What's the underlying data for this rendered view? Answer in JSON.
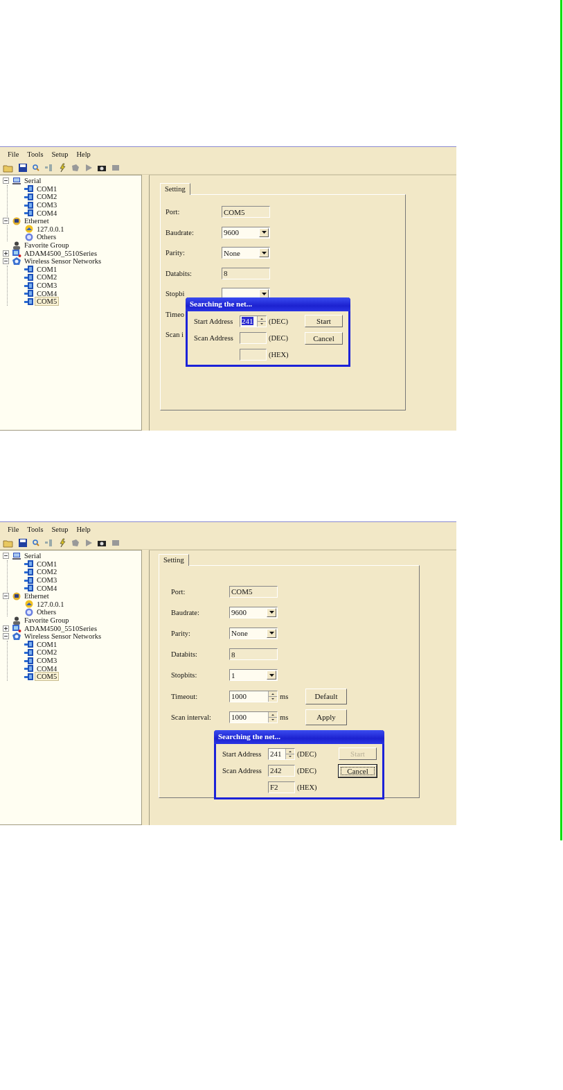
{
  "screenshots": [
    {
      "menu": [
        "File",
        "Tools",
        "Setup",
        "Help"
      ],
      "tree": [
        {
          "label": "Serial",
          "kind": "serial",
          "expanded": true,
          "selected": false,
          "children": [
            {
              "label": "COM1",
              "kind": "port",
              "selected": false
            },
            {
              "label": "COM2",
              "kind": "port",
              "selected": false
            },
            {
              "label": "COM3",
              "kind": "port",
              "selected": false
            },
            {
              "label": "COM4",
              "kind": "port",
              "selected": false
            }
          ]
        },
        {
          "label": "Ethernet",
          "kind": "ethernet",
          "expanded": true,
          "selected": false,
          "children": [
            {
              "label": "127.0.0.1",
              "kind": "host",
              "selected": false
            },
            {
              "label": "Others",
              "kind": "others",
              "selected": false
            }
          ]
        },
        {
          "label": "Favorite Group",
          "kind": "group",
          "selected": false
        },
        {
          "label": "ADAM4500_5510Series",
          "kind": "device",
          "expanded": false,
          "selected": false
        },
        {
          "label": "Wireless Sensor Networks",
          "kind": "wireless",
          "expanded": true,
          "selected": false,
          "children": [
            {
              "label": "COM1",
              "kind": "port",
              "selected": false
            },
            {
              "label": "COM2",
              "kind": "port",
              "selected": false
            },
            {
              "label": "COM3",
              "kind": "port",
              "selected": false
            },
            {
              "label": "COM4",
              "kind": "port",
              "selected": false
            },
            {
              "label": "COM5",
              "kind": "port",
              "selected": true
            }
          ]
        }
      ],
      "tabs": [
        {
          "label": "Setting",
          "selected": true
        }
      ],
      "form": [
        {
          "label": "Port:",
          "kind": "text",
          "value": "COM5"
        },
        {
          "label": "Baudrate:",
          "kind": "dropdown",
          "value": "9600"
        },
        {
          "label": "Parity:",
          "kind": "dropdown",
          "value": "None"
        },
        {
          "label": "Databits:",
          "kind": "text",
          "value": "8"
        },
        {
          "label": "Stopbi",
          "kind": "dropdown"
        },
        {
          "label": "Timeo",
          "kind": "none"
        },
        {
          "label": "Scan i",
          "kind": "none"
        }
      ],
      "dialog": {
        "title": "Searching the net...",
        "rows": [
          {
            "label": "Start Address",
            "kind": "spin",
            "value": "241",
            "value_selected": true,
            "unit": "(DEC)"
          },
          {
            "label": "Scan Address",
            "kind": "text",
            "unit": "(DEC)"
          },
          {
            "kind": "text",
            "unit": "(HEX)"
          }
        ],
        "buttons": [
          {
            "label": "Start",
            "disabled": false,
            "focused": false
          },
          {
            "label": "Cancel",
            "disabled": false,
            "focused": false
          }
        ]
      }
    },
    {
      "menu": [
        "File",
        "Tools",
        "Setup",
        "Help"
      ],
      "tree": [
        {
          "label": "Serial",
          "kind": "serial",
          "expanded": true,
          "selected": false,
          "children": [
            {
              "label": "COM1",
              "kind": "port",
              "selected": false
            },
            {
              "label": "COM2",
              "kind": "port",
              "selected": false
            },
            {
              "label": "COM3",
              "kind": "port",
              "selected": false
            },
            {
              "label": "COM4",
              "kind": "port",
              "selected": false
            }
          ]
        },
        {
          "label": "Ethernet",
          "kind": "ethernet",
          "expanded": true,
          "selected": false,
          "children": [
            {
              "label": "127.0.0.1",
              "kind": "host",
              "selected": false
            },
            {
              "label": "Others",
              "kind": "others",
              "selected": false
            }
          ]
        },
        {
          "label": "Favorite Group",
          "kind": "group",
          "selected": false
        },
        {
          "label": "ADAM4500_5510Series",
          "kind": "device",
          "expanded": false,
          "selected": false
        },
        {
          "label": "Wireless Sensor Networks",
          "kind": "wireless",
          "expanded": true,
          "selected": false,
          "children": [
            {
              "label": "COM1",
              "kind": "port",
              "selected": false
            },
            {
              "label": "COM2",
              "kind": "port",
              "selected": false
            },
            {
              "label": "COM3",
              "kind": "port",
              "selected": false
            },
            {
              "label": "COM4",
              "kind": "port",
              "selected": false
            },
            {
              "label": "COM5",
              "kind": "port",
              "selected": true
            }
          ]
        }
      ],
      "tabs": [
        {
          "label": "Setting",
          "selected": true
        }
      ],
      "form": [
        {
          "label": "Port:",
          "kind": "text",
          "value": "COM5"
        },
        {
          "label": "Baudrate:",
          "kind": "dropdown",
          "value": "9600"
        },
        {
          "label": "Parity:",
          "kind": "dropdown",
          "value": "None"
        },
        {
          "label": "Databits:",
          "kind": "text",
          "value": "8"
        },
        {
          "label": "Stopbits:",
          "kind": "dropdown",
          "value": "1"
        },
        {
          "label": "Timeout:",
          "kind": "spin",
          "value": "1000",
          "unit": "ms",
          "button": "Default"
        },
        {
          "label": "Scan interval:",
          "kind": "spin",
          "value": "1000",
          "unit": "ms",
          "button": "Apply"
        }
      ],
      "dialog": {
        "title": "Searching the net...",
        "rows": [
          {
            "label": "Start Address",
            "kind": "spin",
            "value": "241",
            "value_selected": false,
            "unit": "(DEC)"
          },
          {
            "label": "Scan Address",
            "kind": "text",
            "value": "242",
            "unit": "(DEC)"
          },
          {
            "kind": "text",
            "value": "F2",
            "unit": "(HEX)"
          }
        ],
        "buttons": [
          {
            "label": "Start",
            "disabled": true,
            "focused": false
          },
          {
            "label": "Cancel",
            "disabled": false,
            "focused": true
          }
        ]
      }
    }
  ]
}
